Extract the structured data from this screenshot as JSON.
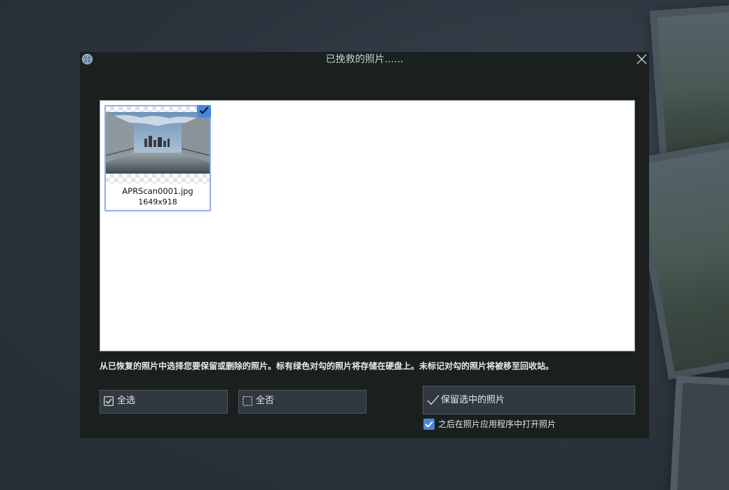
{
  "window": {
    "title": "已挽救的照片......"
  },
  "photos": [
    {
      "filename": "APRScan0001.jpg",
      "dimensions": "1649x918",
      "selected": true
    }
  ],
  "instruction": "从已恢复的照片中选择您要保留或删除的照片。标有绿色对勾的照片将存储在硬盘上。未标记对勾的照片将被移至回收站。",
  "buttons": {
    "select_all": "全选",
    "select_none": "全否",
    "keep_selected": "保留选中的照片"
  },
  "options": {
    "open_after": {
      "label": "之后在照片应用程序中打开照片",
      "checked": true
    }
  },
  "icons": {
    "app": "app-logo-icon",
    "close": "close-icon",
    "select_all": "checked-box-icon",
    "select_none": "dashed-box-icon",
    "keep": "checkmark-icon"
  },
  "colors": {
    "accent": "#4a84e0",
    "dialog_bg": "#1b201f",
    "button_bg": "#30393f"
  }
}
